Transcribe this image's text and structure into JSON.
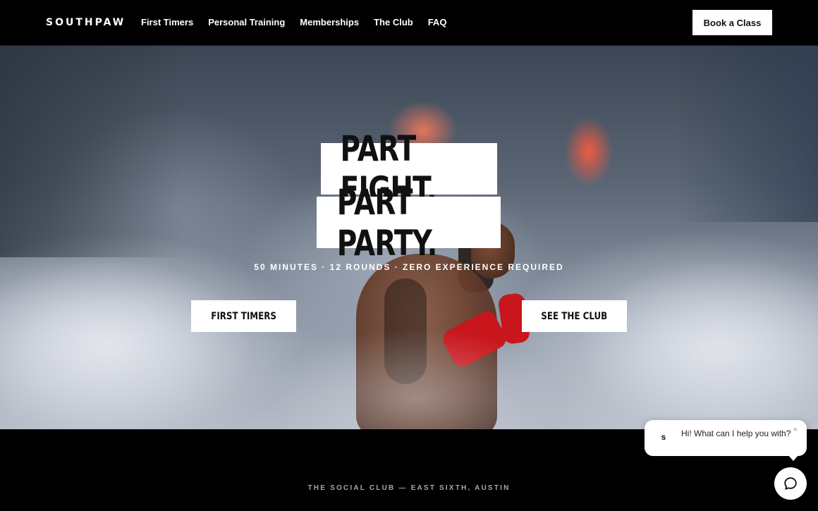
{
  "header": {
    "logo": "SOUTHPAW",
    "nav": [
      {
        "label": "First Timers"
      },
      {
        "label": "Personal Training"
      },
      {
        "label": "Memberships"
      },
      {
        "label": "The Club"
      },
      {
        "label": "FAQ"
      }
    ],
    "cta_label": "Book a Class"
  },
  "hero": {
    "headline_line1": "PART FIGHT.",
    "headline_line2": "PART PARTY.",
    "tagline": "50 MINUTES · 12 ROUNDS · ZERO EXPERIENCE REQUIRED",
    "button_left": "FIRST TIMERS",
    "button_right": "SEE THE CLUB"
  },
  "section": {
    "label": "THE SOCIAL CLUB — EAST SIXTH, AUSTIN"
  },
  "chat": {
    "avatar_letter": "s",
    "message": "Hi! What can I help you with?",
    "close_glyph": "×",
    "launcher_icon": "chat-bubble-icon"
  },
  "colors": {
    "background": "#000000",
    "button_bg": "#ffffff",
    "glove_red": "#c8161c"
  }
}
